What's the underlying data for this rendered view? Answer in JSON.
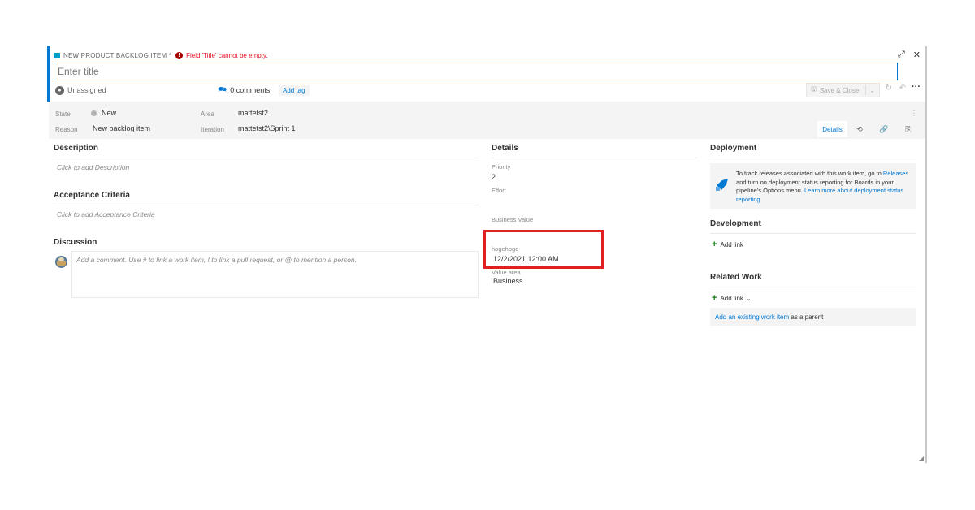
{
  "header": {
    "work_item_type": "NEW PRODUCT BACKLOG ITEM *",
    "error_message": "Field 'Title' cannot be empty.",
    "title_placeholder": "Enter title",
    "assigned_to": "Unassigned",
    "comments_count": "0 comments",
    "add_tag_label": "Add tag",
    "save_close_label": "Save & Close"
  },
  "fields": {
    "state_label": "State",
    "state_value": "New",
    "reason_label": "Reason",
    "reason_value": "New backlog item",
    "area_label": "Area",
    "area_value": "mattetst2",
    "iteration_label": "Iteration",
    "iteration_value": "mattetst2\\Sprint 1"
  },
  "tabs": {
    "details_label": "Details"
  },
  "left_column": {
    "description_title": "Description",
    "description_placeholder": "Click to add Description",
    "acceptance_title": "Acceptance Criteria",
    "acceptance_placeholder": "Click to add Acceptance Criteria",
    "discussion_title": "Discussion",
    "comment_placeholder": "Add a comment. Use # to link a work item, ! to link a pull request, or @ to mention a person."
  },
  "details": {
    "title": "Details",
    "priority_label": "Priority",
    "priority_value": "2",
    "effort_label": "Effort",
    "effort_value": "",
    "business_value_label": "Business Value",
    "business_value_value": "",
    "hogehoge_label": "hogehoge",
    "hogehoge_value": "12/2/2021 12:00 AM",
    "value_area_label": "Value area",
    "value_area_value": "Business"
  },
  "right_column": {
    "deployment_title": "Deployment",
    "deployment_text_1": "To track releases associated with this work item, go to ",
    "deployment_link_releases": "Releases",
    "deployment_text_2": " and turn on deployment status reporting for Boards in your pipeline's Options menu. ",
    "deployment_link_learn": "Learn more about deployment status reporting",
    "development_title": "Development",
    "add_link_label": "Add link",
    "related_work_title": "Related Work",
    "related_add_link_label": "Add link",
    "existing_item_link": "Add an existing work item",
    "existing_item_suffix": " as a parent"
  },
  "icons": {
    "work_item_icon": "book-icon",
    "error_icon": "error-icon",
    "expand_icon": "expand-icon",
    "close_icon": "close-icon",
    "more_icon": "more-icon"
  },
  "colors": {
    "accent": "#0078d4",
    "error": "#e81123",
    "highlight_box": "#e02020",
    "header_band": "#f4f4f4"
  }
}
